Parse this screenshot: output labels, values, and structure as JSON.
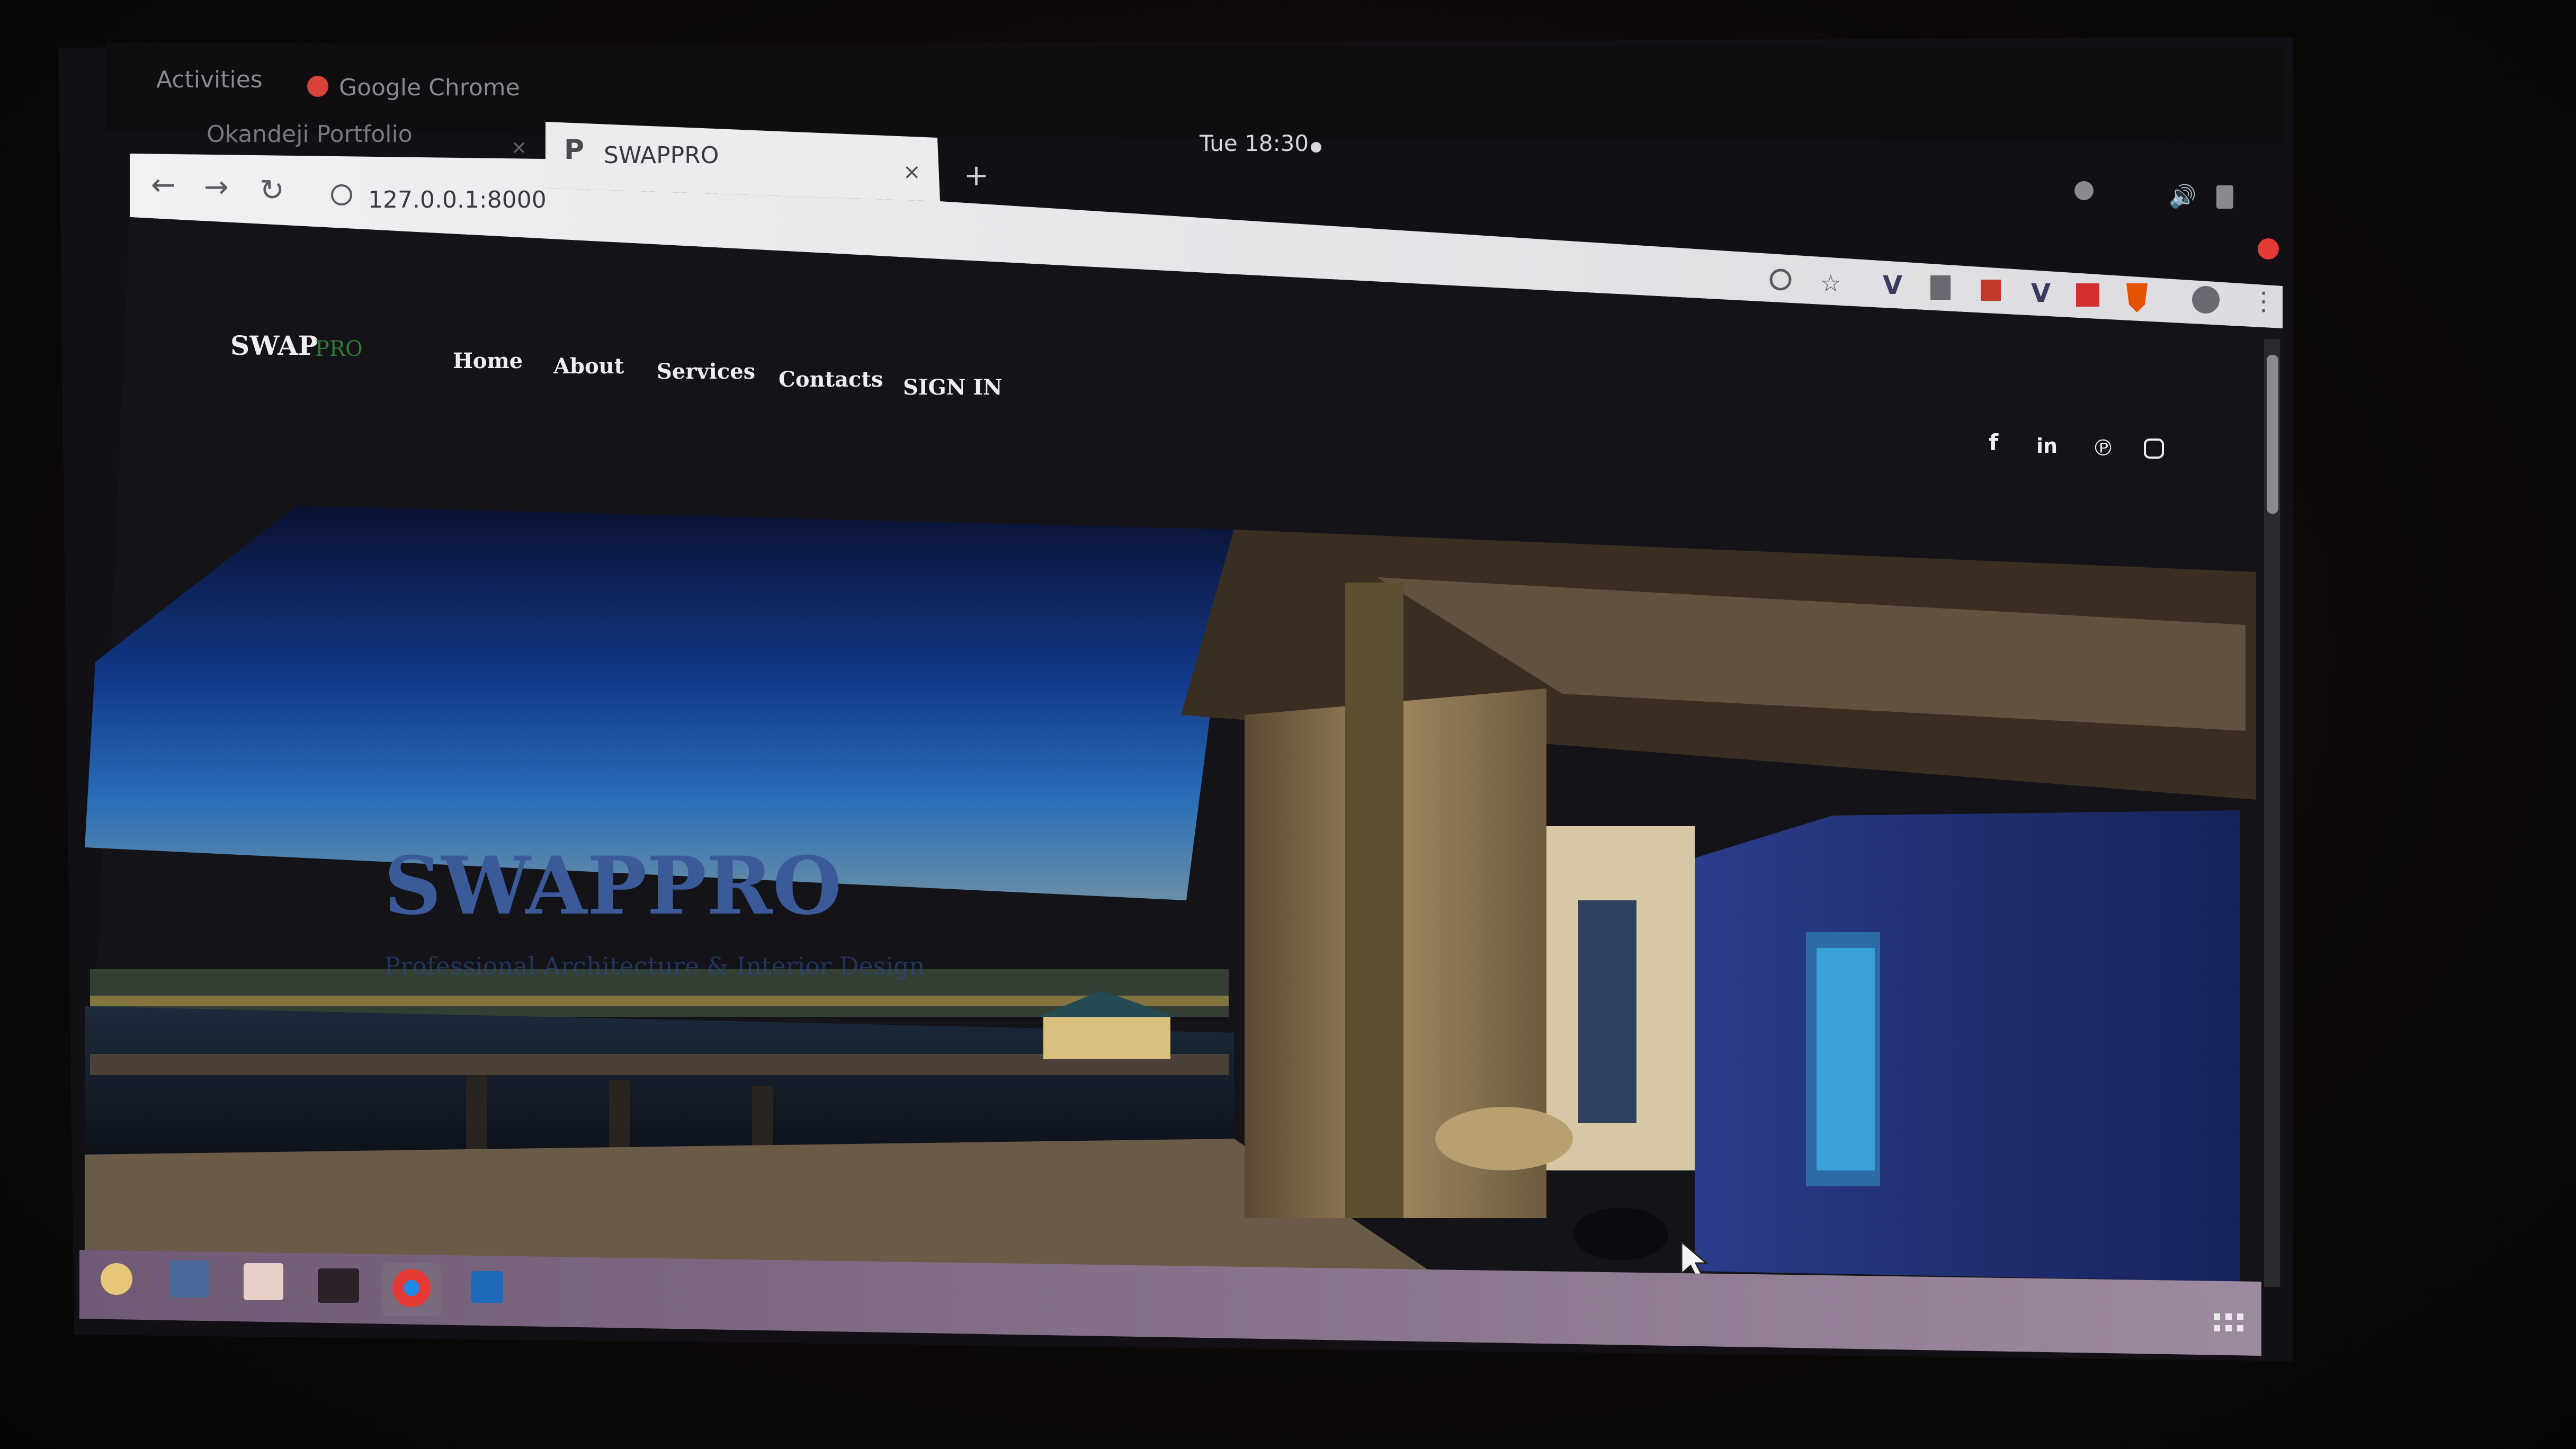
{
  "desktop": {
    "activities_label": "Activities",
    "app_menu_label": "Google Chrome",
    "clock": "Tue 18:30"
  },
  "browser": {
    "tabs": [
      {
        "label": "Okandeji Portfolio",
        "active": false
      },
      {
        "label": "SWAPPRO",
        "active": true,
        "favicon": "P"
      }
    ],
    "new_tab_label": "+",
    "url": "127.0.0.1:8000",
    "nav_icons": [
      "back-arrow-icon",
      "forward-arrow-icon",
      "reload-icon",
      "info-icon"
    ],
    "toolbar_icons": [
      "zoom-icon",
      "bookmark-star-icon",
      "extension-v-icon",
      "extension-doc-icon",
      "extension-red-icon",
      "extension-v2-icon",
      "extension-red2-icon",
      "brave-shield-icon",
      "profile-avatar-icon",
      "menu-kebab-icon"
    ],
    "system_icons": [
      "accessibility-icon",
      "volume-icon",
      "power-icon"
    ]
  },
  "site": {
    "logo_main": "SWAP",
    "logo_accent": "PRO",
    "nav": [
      "Home",
      "About",
      "Services",
      "Contacts",
      "SIGN IN"
    ],
    "social_icons": [
      "facebook-icon",
      "linkedin-icon",
      "pinterest-icon",
      "instagram-icon"
    ],
    "hero_title": "SWAPPRO",
    "hero_subtitle": "Professional Architecture & Interior Design"
  },
  "dock": {
    "apps": [
      "settings-app-icon",
      "network-app-icon",
      "files-app-icon",
      "terminal-app-icon",
      "chrome-app-icon",
      "vscode-app-icon"
    ],
    "grid_icon": "app-grid-icon"
  },
  "colors": {
    "site_bg": "#141418",
    "chrome_bar": "#e9e9ec",
    "tab_strip": "#2a2a30",
    "dock_bg": "#6a5a72",
    "logo_accent": "#2e7d32"
  }
}
